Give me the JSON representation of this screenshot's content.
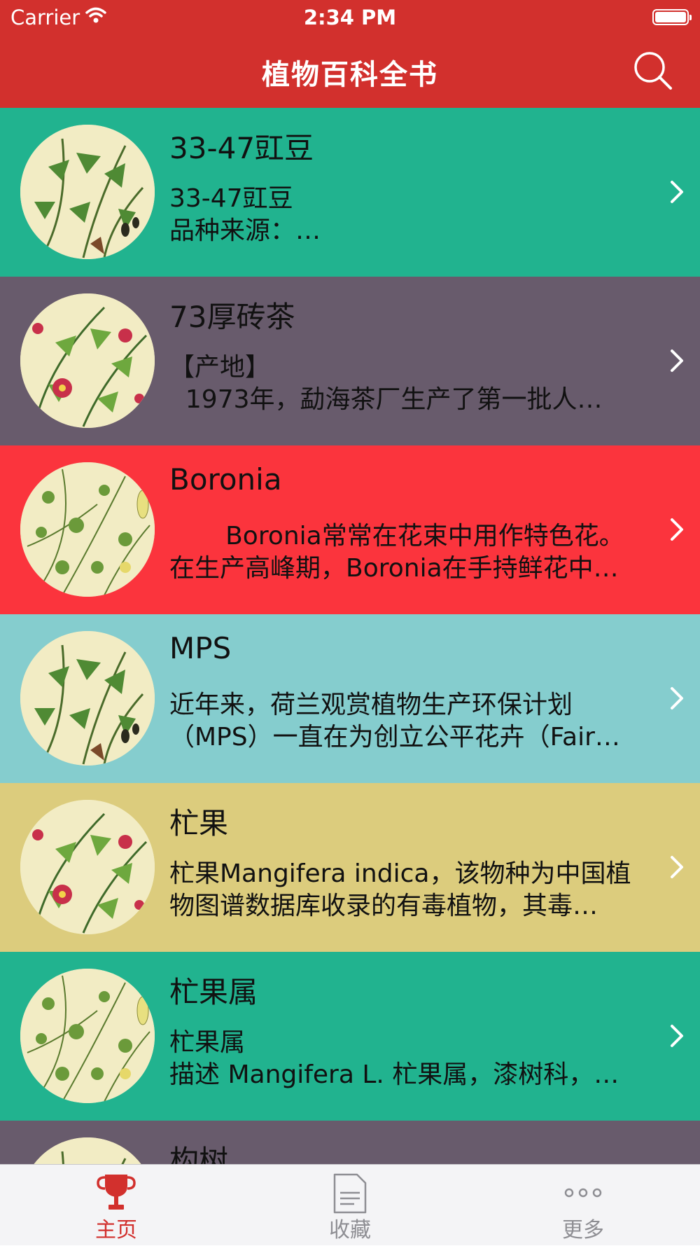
{
  "status_bar": {
    "carrier": "Carrier",
    "time": "2:34 PM"
  },
  "nav": {
    "title": "植物百科全书"
  },
  "colors": {
    "brand": "#d2302d",
    "row_colors": [
      "#21b38f",
      "#685b6c",
      "#fb343d",
      "#85cdce",
      "#dccc7d",
      "#21b38f",
      "#685b6c"
    ],
    "tab_active": "#d2302d",
    "tab_inactive": "#8e8e93"
  },
  "list": {
    "items": [
      {
        "title": "33-47豇豆",
        "desc": [
          "33-47豇豆",
          "品种来源：…"
        ]
      },
      {
        "title": "73厚砖茶",
        "desc": [
          "【产地】",
          "  1973年，勐海茶厂生产了第一批人…"
        ]
      },
      {
        "title": "Boronia",
        "desc": [
          "       Boronia常常在花束中用作特色花。",
          "在生产高峰期，Boronia在手持鲜花中…"
        ]
      },
      {
        "title": "MPS",
        "desc": [
          "近年来，荷兰观赏植物生产环保计划",
          "（MPS）一直在为创立公平花卉（Fair…"
        ]
      },
      {
        "title": "杧果",
        "desc": [
          "杧果Mangifera indica，该物种为中国植",
          "物图谱数据库收录的有毒植物，其毒…"
        ]
      },
      {
        "title": "杧果属",
        "desc": [
          "杧果属",
          "描述 Mangifera L. 杧果属，漆树科，…"
        ]
      },
      {
        "title": "构树",
        "desc": [
          "",
          ""
        ]
      }
    ]
  },
  "tabs": [
    {
      "label": "主页",
      "icon": "trophy-icon",
      "active": true
    },
    {
      "label": "收藏",
      "icon": "document-icon",
      "active": false
    },
    {
      "label": "更多",
      "icon": "more-dots-icon",
      "active": false
    }
  ]
}
